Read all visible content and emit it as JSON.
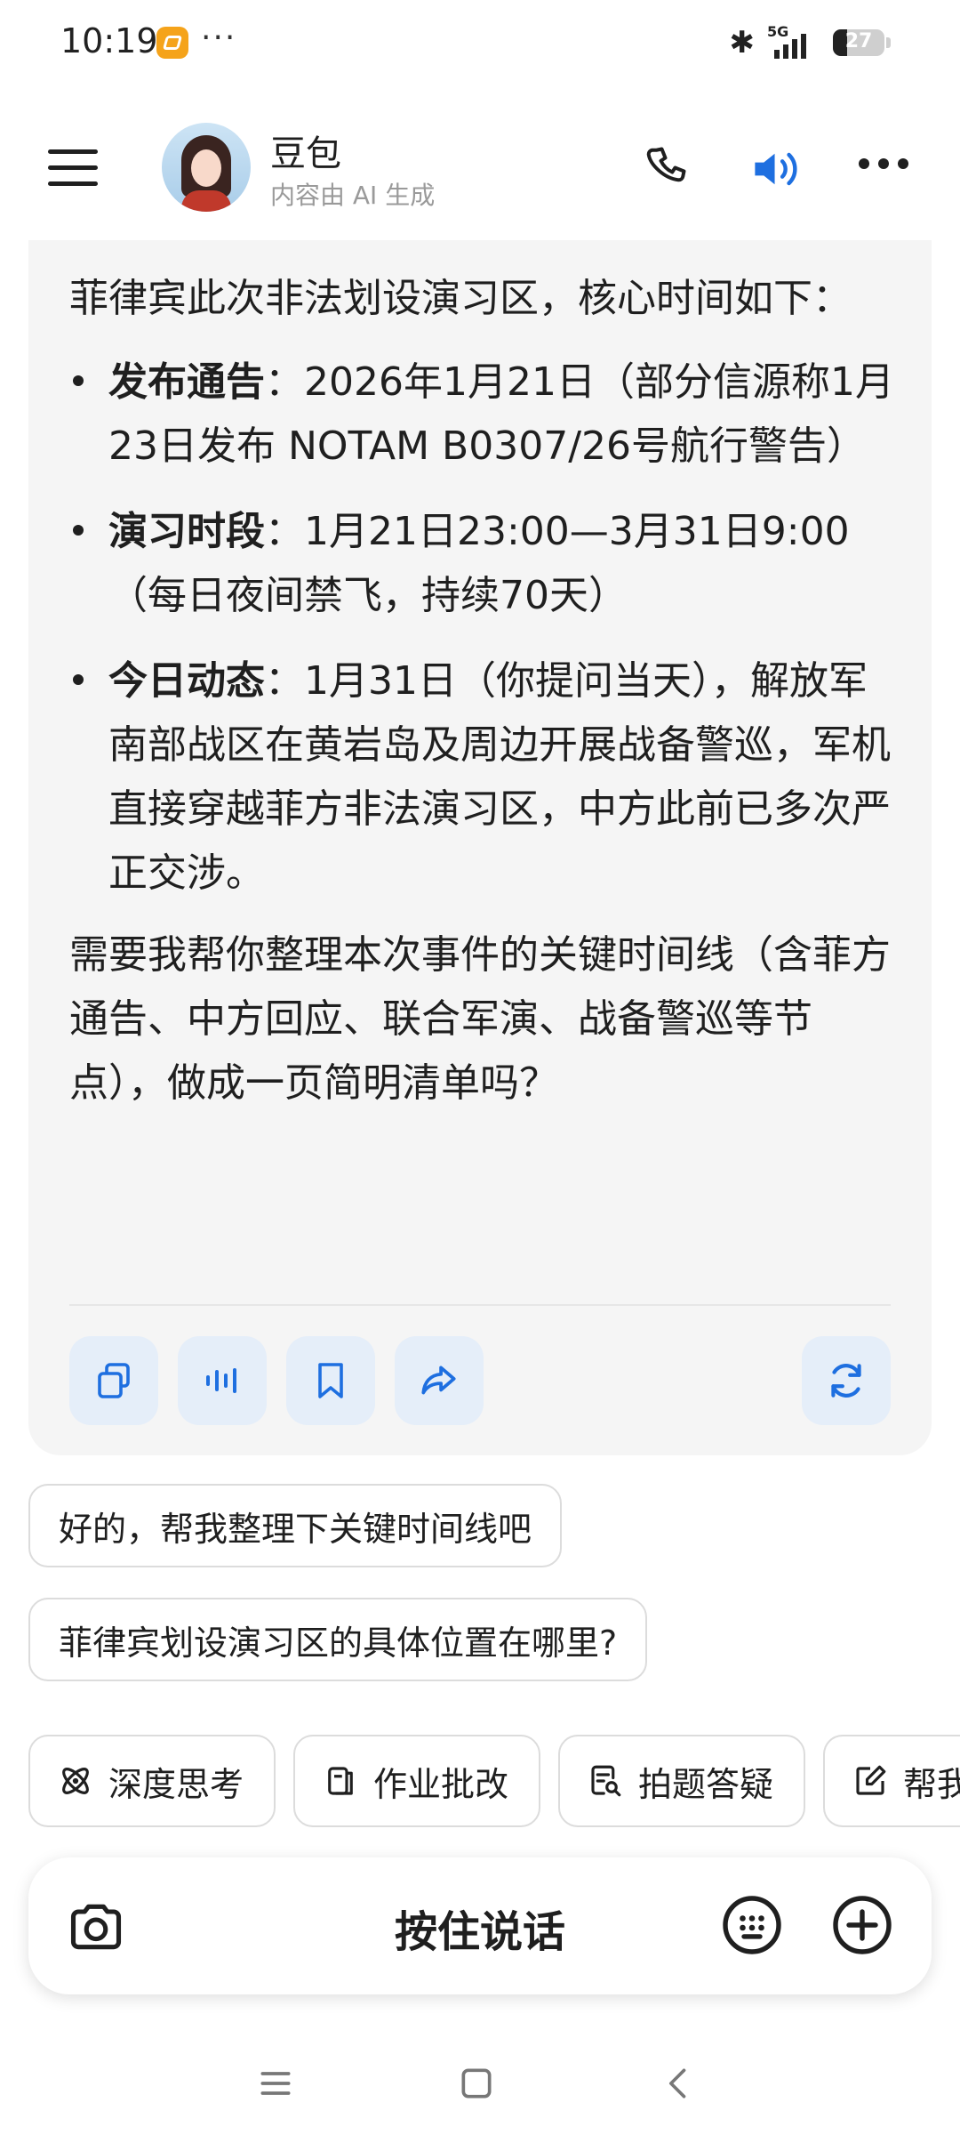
{
  "status_bar": {
    "time": "10:19",
    "more": "···",
    "network": "5G",
    "battery": "27",
    "battery_level": 0.27
  },
  "header": {
    "bot_name": "豆包",
    "subtitle": "内容由 AI 生成",
    "icons": [
      "menu-icon",
      "avatar",
      "phone-icon",
      "speaker-icon",
      "more-icon"
    ]
  },
  "message": {
    "intro": "菲律宾此次非法划设演习区，核心时间如下：",
    "items": [
      {
        "label": "发布通告",
        "text": "：2026年1月21日（部分信源称1月23日发布 NOTAM B0307/26号航行警告）"
      },
      {
        "label": "演习时段",
        "text": "：1月21日23:00—3月31日9:00（每日夜间禁飞，持续70天）"
      },
      {
        "label": "今日动态",
        "text": "：1月31日（你提问当天），解放军南部战区在黄岩岛及周边开展战备警巡，军机直接穿越菲方非法演习区，中方此前已多次严正交涉。"
      }
    ],
    "outro": "需要我帮你整理本次事件的关键时间线（含菲方通告、中方回应、联合军演、战备警巡等节点），做成一页简明清单吗？",
    "actions": [
      "copy-icon",
      "voice-playback-icon",
      "bookmark-icon",
      "share-icon",
      "regenerate-icon"
    ]
  },
  "suggestions": [
    "好的，帮我整理下关键时间线吧",
    "菲律宾划设演习区的具体位置在哪里?"
  ],
  "tools": [
    "深度思考",
    "作业批改",
    "拍题答疑",
    "帮我"
  ],
  "input_bar": {
    "hold_to_talk": "按住说话"
  },
  "colors": {
    "accent": "#1e6fe0",
    "card_bg": "#f5f5f5",
    "action_bg": "#e5eef9"
  }
}
